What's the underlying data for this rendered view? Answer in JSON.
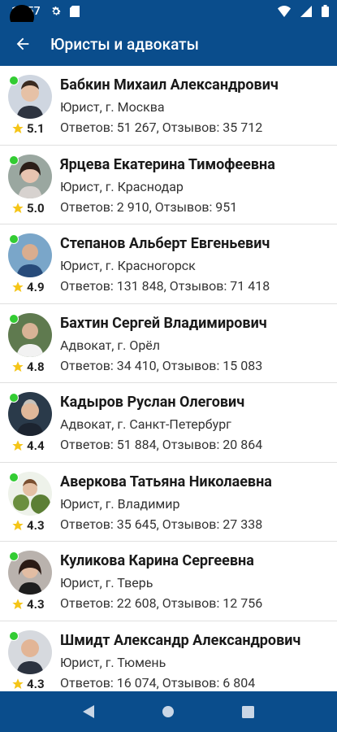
{
  "status_bar": {
    "time": "13:57"
  },
  "app_bar": {
    "title": "Юристы и адвокаты"
  },
  "lawyers": [
    {
      "name": "Бабкин Михаил Александрович",
      "role": "Юрист, г. Москва",
      "stats": "Ответов: 51 267, Отзывов: 35 712",
      "rating": "5.1"
    },
    {
      "name": "Ярцева Екатерина Тимофеевна",
      "role": "Юрист, г. Краснодар",
      "stats": "Ответов: 2 910, Отзывов: 951",
      "rating": "5.0"
    },
    {
      "name": "Степанов Альберт Евгеньевич",
      "role": "Юрист, г. Красногорск",
      "stats": "Ответов: 131 848, Отзывов: 71 418",
      "rating": "4.9"
    },
    {
      "name": "Бахтин Сергей Владимирович",
      "role": "Адвокат, г. Орёл",
      "stats": "Ответов: 34 410, Отзывов: 15 083",
      "rating": "4.8"
    },
    {
      "name": "Кадыров Руслан Олегович",
      "role": "Адвокат, г. Санкт-Петербург",
      "stats": "Ответов: 51 884, Отзывов: 20 864",
      "rating": "4.4"
    },
    {
      "name": "Аверкова Татьяна Николаевна",
      "role": "Юрист, г. Владимир",
      "stats": "Ответов: 35 645, Отзывов: 27 338",
      "rating": "4.3"
    },
    {
      "name": "Куликова Карина Сергеевна",
      "role": "Юрист, г. Тверь",
      "stats": "Ответов: 22 608, Отзывов: 12 756",
      "rating": "4.3"
    },
    {
      "name": "Шмидт Александр Александрович",
      "role": "Юрист, г. Тюмень",
      "stats": "Ответов: 16 074, Отзывов: 6 804",
      "rating": "4.3"
    }
  ],
  "colors": {
    "primary": "#0a4d8c",
    "online": "#33cc33",
    "star": "#f5c518"
  },
  "icons": {
    "status": [
      "gear-icon",
      "sd-card-icon",
      "wifi-icon",
      "cellular-icon",
      "battery-icon"
    ],
    "nav": [
      "back-triangle-icon",
      "home-circle-icon",
      "recents-square-icon"
    ]
  }
}
